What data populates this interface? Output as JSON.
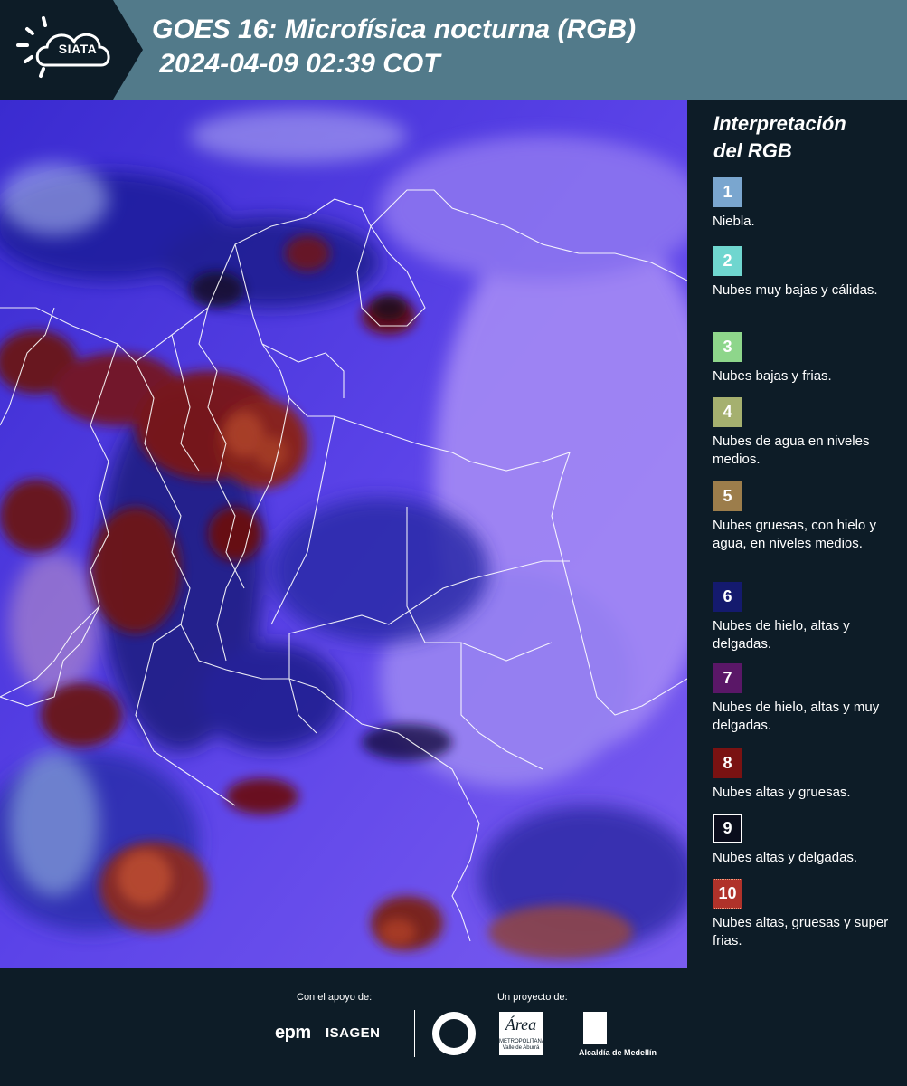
{
  "header": {
    "logo_text": "SIATA",
    "title": "GOES 16: Microfísica nocturna (RGB)\n 2024-04-09 02:39 COT"
  },
  "legend": {
    "title": "Interpretación\ndel RGB",
    "items": [
      {
        "number": "1",
        "label": "Niebla.",
        "color": "#7aa6cf"
      },
      {
        "number": "2",
        "label": "Nubes muy bajas y cálidas.",
        "color": "#6fd6cf"
      },
      {
        "number": "3",
        "label": "Nubes bajas y frias.",
        "color": "#8ed68b"
      },
      {
        "number": "4",
        "label": "Nubes de agua en niveles medios.",
        "color": "#a5b06f"
      },
      {
        "number": "5",
        "label": "Nubes gruesas, con hielo y agua, en niveles medios.",
        "color": "#9c7d4b"
      },
      {
        "number": "6",
        "label": "Nubes de hielo, altas y delgadas.",
        "color": "#141a6e"
      },
      {
        "number": "7",
        "label": "Nubes de hielo, altas y muy delgadas.",
        "color": "#5a1767"
      },
      {
        "number": "8",
        "label": "Nubes altas y gruesas.",
        "color": "#7a1212"
      },
      {
        "number": "9",
        "label": "Nubes altas y delgadas.",
        "color": "#0a0d1c"
      },
      {
        "number": "10",
        "label": "Nubes altas, gruesas y super frias.",
        "color": "#b0322a"
      }
    ]
  },
  "footer": {
    "support_label": "Con el apoyo de:",
    "project_label": "Un proyecto de:",
    "epm": "epm",
    "isagen": "ISAGEN",
    "area_title": "Área",
    "area_sub": "METROPOLITANA\nValle de Aburrá",
    "alcaldia": "Alcaldía de Medellín"
  }
}
